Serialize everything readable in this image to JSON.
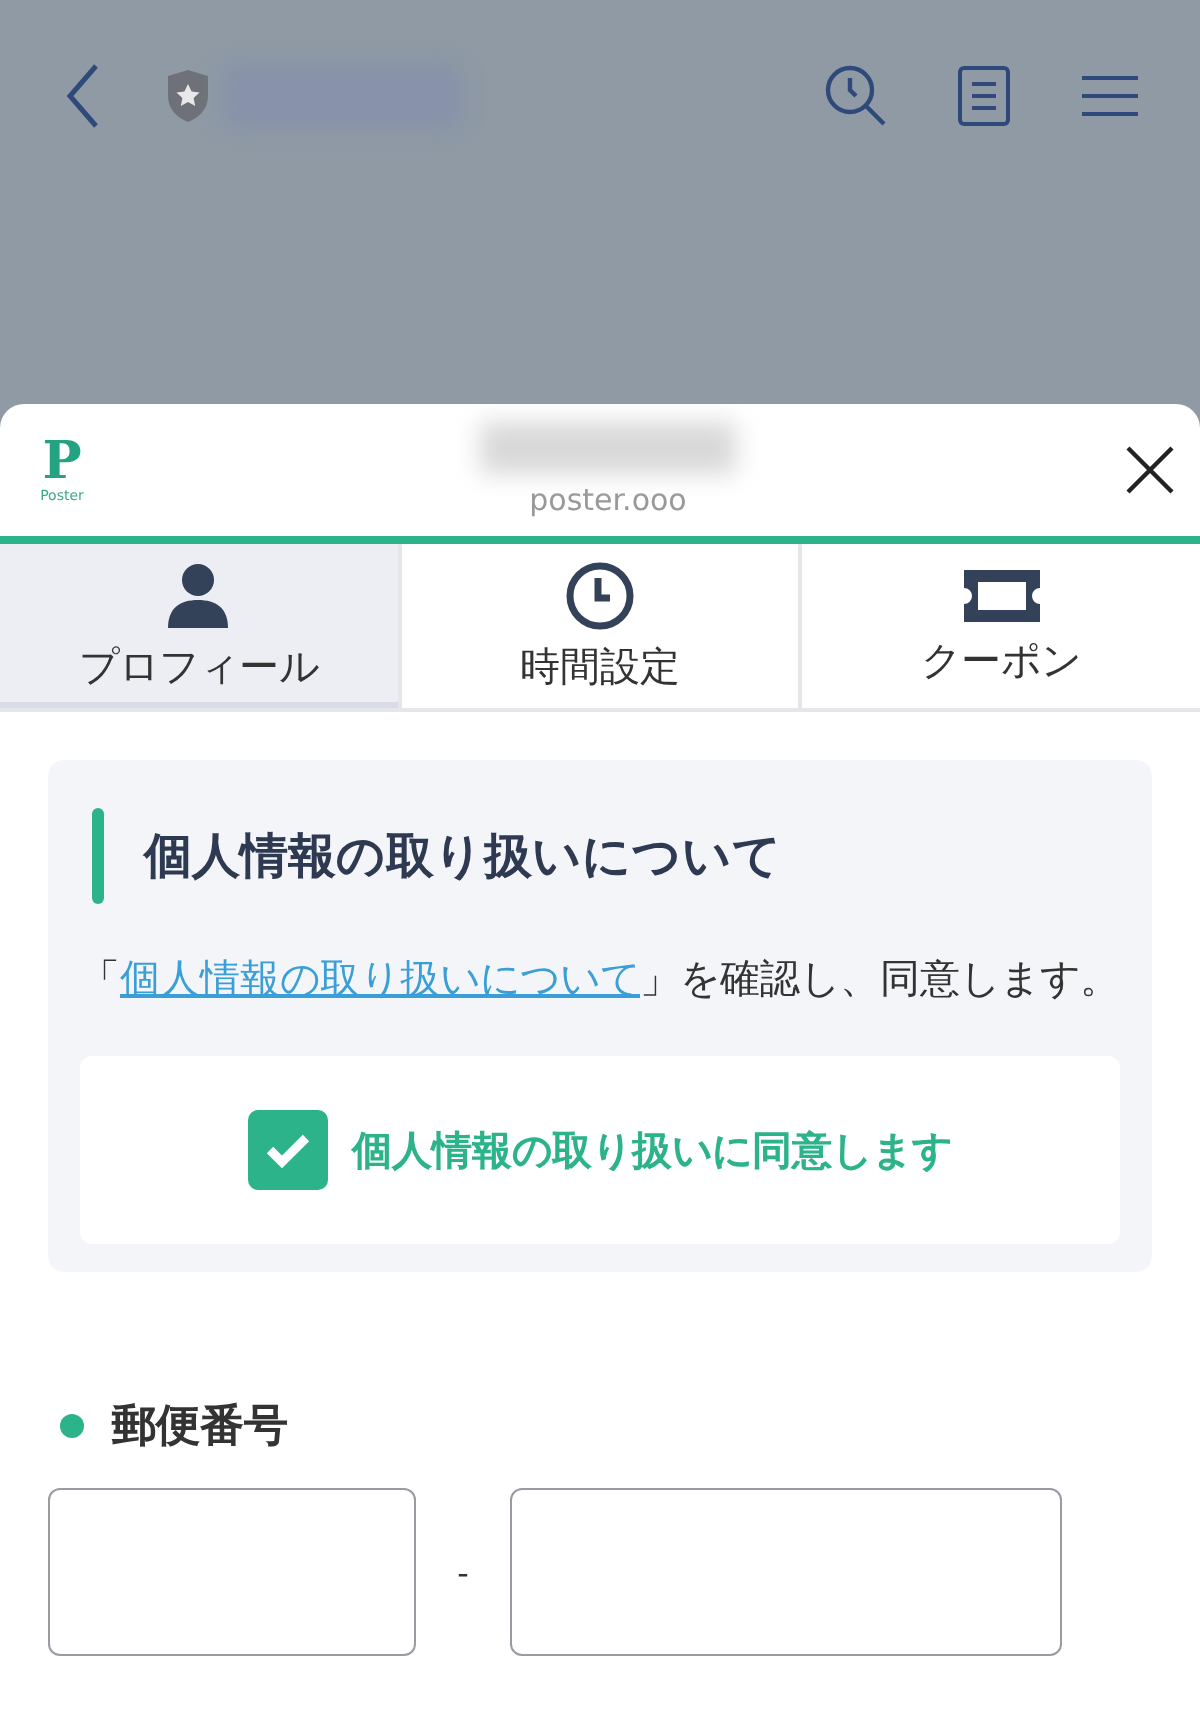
{
  "sheet_header": {
    "logo": {
      "letter": "P",
      "word": "Poster"
    },
    "domain": "poster.ooo"
  },
  "tabs": [
    {
      "label": "プロフィール",
      "kind": "person",
      "selected": true
    },
    {
      "label": "時間設定",
      "kind": "clock",
      "selected": false
    },
    {
      "label": "クーポン",
      "kind": "ticket",
      "selected": false
    }
  ],
  "consent": {
    "title": "個人情報の取り扱いについて",
    "text_before": "「",
    "link": "個人情報の取り扱いについて",
    "text_after": "」を確認し、同意します。",
    "checkbox": {
      "label": "個人情報の取り扱いに同意します",
      "checked": true
    }
  },
  "postal_code": {
    "label": "郵便番号",
    "separator": "-"
  }
}
